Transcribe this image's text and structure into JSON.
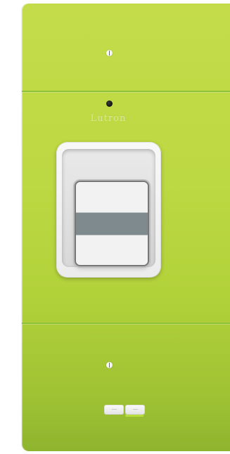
{
  "brand": {
    "name": "Lutron"
  },
  "device": {
    "type": "dimmer-switch-wallplate",
    "plate_color": "#bcd842",
    "rocker_band_color": "#7e8a8d",
    "indicator_color": "#b9dd3a",
    "screw_icons": [
      "screw-icon",
      "screw-icon"
    ],
    "sensor_icon": "sensor-led-icon"
  }
}
